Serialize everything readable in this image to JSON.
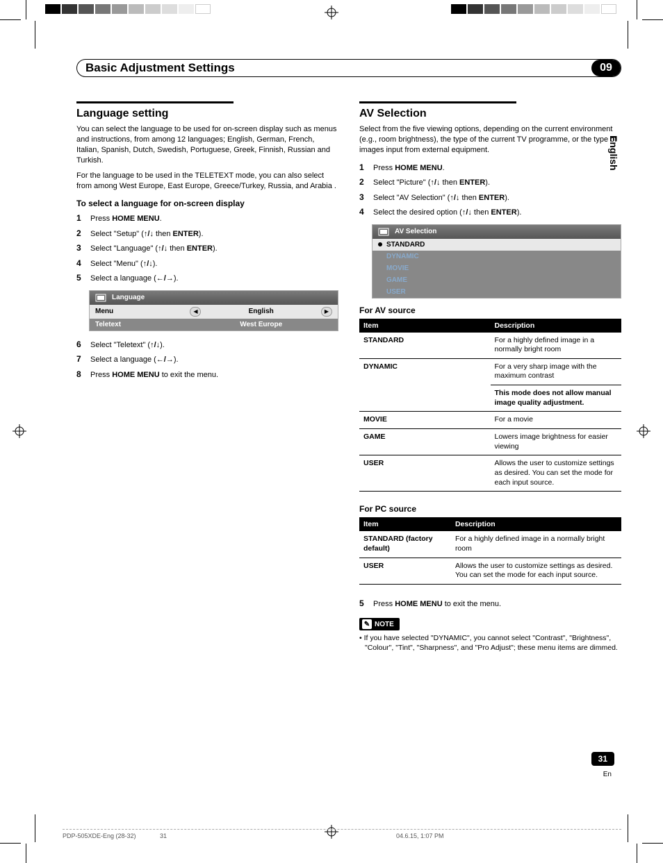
{
  "chapter": {
    "title": "Basic Adjustment Settings",
    "number": "09"
  },
  "side_tab": "English",
  "page_number": "31",
  "page_lang": "En",
  "footer": {
    "left": "PDP-505XDE-Eng (28-32)",
    "center": "31",
    "right": "04.6.15, 1:07 PM"
  },
  "left_col": {
    "title": "Language setting",
    "intro1": "You can select the language to be used for on-screen display such as menus and instructions, from among 12 languages; English, German, French, Italian, Spanish, Dutch, Swedish, Portuguese, Greek, Finnish, Russian and Turkish.",
    "intro2": "For the language to be used in the TELETEXT mode, you can also select from among West Europe, East Europe, Greece/Turkey, Russia, and Arabia .",
    "subhead": "To select a language for on-screen display",
    "steps_a": [
      {
        "n": "1",
        "pre": "Press ",
        "bold": "HOME MENU",
        "post": "."
      },
      {
        "n": "2",
        "pre": "Select \"Setup\" (",
        "arrows": "↑/↓",
        "mid": " then ",
        "bold": "ENTER",
        "post": ")."
      },
      {
        "n": "3",
        "pre": "Select \"Language\" (",
        "arrows": "↑/↓",
        "mid": " then ",
        "bold": "ENTER",
        "post": ")."
      },
      {
        "n": "4",
        "pre": "Select \"Menu\" (",
        "arrows": "↑/↓",
        "post": ")."
      },
      {
        "n": "5",
        "pre": "Select a language (",
        "arrows": "←/→",
        "post": ")."
      }
    ],
    "ui": {
      "header": "Language",
      "rows": [
        {
          "label": "Menu",
          "value": "English",
          "selected": true
        },
        {
          "label": "Teletext",
          "value": "West Europe",
          "selected": false
        }
      ]
    },
    "steps_b": [
      {
        "n": "6",
        "pre": "Select \"Teletext\" (",
        "arrows": "↑/↓",
        "post": ")."
      },
      {
        "n": "7",
        "pre": "Select a language (",
        "arrows": "←/→",
        "post": ")."
      },
      {
        "n": "8",
        "pre": "Press ",
        "bold": "HOME MENU",
        "post": " to exit the menu."
      }
    ]
  },
  "right_col": {
    "title": "AV Selection",
    "intro": "Select from the five viewing options, depending on the current environment (e.g., room brightness), the type of the current TV programme, or the type of images input from external equipment.",
    "steps": [
      {
        "n": "1",
        "pre": "Press ",
        "bold": "HOME MENU",
        "post": "."
      },
      {
        "n": "2",
        "pre": "Select \"Picture\" (",
        "arrows": "↑/↓",
        "mid": " then ",
        "bold": "ENTER",
        "post": ")."
      },
      {
        "n": "3",
        "pre": "Select \"AV Selection\" (",
        "arrows": "↑/↓",
        "mid": " then ",
        "bold": "ENTER",
        "post": ")."
      },
      {
        "n": "4",
        "pre": "Select the desired option (",
        "arrows": "↑/↓",
        "mid": " then ",
        "bold": "ENTER",
        "post": ")."
      }
    ],
    "ui": {
      "header": "AV Selection",
      "options": [
        "STANDARD",
        "DYNAMIC",
        "MOVIE",
        "GAME",
        "USER"
      ]
    },
    "table_av": {
      "caption": "For AV source",
      "headers": [
        "Item",
        "Description"
      ],
      "rows": [
        {
          "item": "STANDARD",
          "desc": "For a highly defined image in a normally bright room"
        },
        {
          "item": "DYNAMIC",
          "desc": "For a very sharp image with the maximum contrast",
          "desc2": "This mode does not allow manual image quality adjustment."
        },
        {
          "item": "MOVIE",
          "desc": "For a movie"
        },
        {
          "item": "GAME",
          "desc": "Lowers image brightness for easier viewing"
        },
        {
          "item": "USER",
          "desc": "Allows the user to customize settings as desired. You can set the mode for each input source."
        }
      ]
    },
    "table_pc": {
      "caption": "For PC source",
      "headers": [
        "Item",
        "Description"
      ],
      "rows": [
        {
          "item": "STANDARD (factory default)",
          "desc": "For a highly defined image in a normally bright room"
        },
        {
          "item": "USER",
          "desc": "Allows the user to customize settings as desired. You can set the mode for each input source."
        }
      ]
    },
    "step5": {
      "n": "5",
      "pre": "Press ",
      "bold": "HOME MENU",
      "post": " to exit the menu."
    },
    "note_label": "NOTE",
    "note_text": "• If you have selected \"DYNAMIC\", you cannot select \"Contrast\", \"Brightness\", \"Colour\", \"Tint\", \"Sharpness\", and \"Pro Adjust\"; these menu items are dimmed."
  }
}
